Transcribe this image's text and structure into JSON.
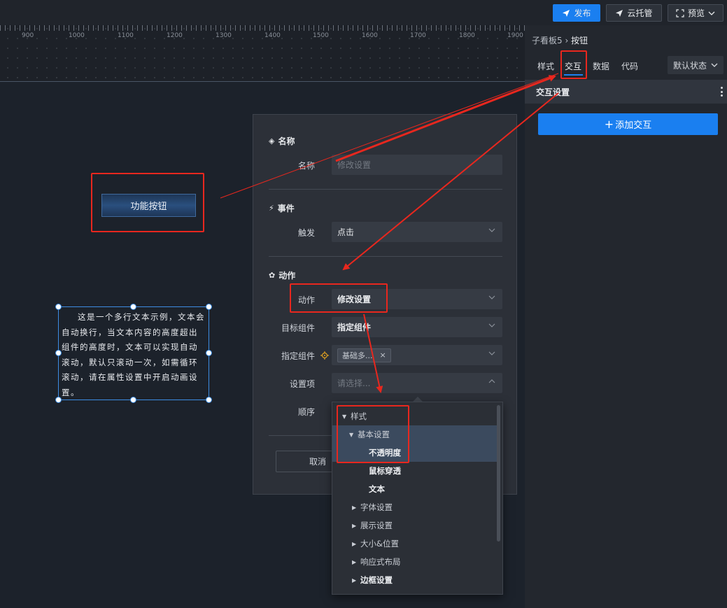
{
  "toolbar": {
    "publish_label": "发布",
    "cloud_label": "云托管",
    "preview_label": "预览"
  },
  "ruler": {
    "labels": [
      "900",
      "1000",
      "1100",
      "1200",
      "1300",
      "1400",
      "1500",
      "1600",
      "1700",
      "1800",
      "1900"
    ]
  },
  "canvas": {
    "function_button_label": "功能按钮",
    "text_widget_content": "这是一个多行文本示例，文本会自动换行，当文本内容的高度超出组件的高度时，文本可以实现自动滚动，默认只滚动一次，如需循环滚动，请在属性设置中开启动画设置。"
  },
  "dialog": {
    "name_section": "名称",
    "name_label": "名称",
    "name_placeholder": "修改设置",
    "event_section": "事件",
    "trigger_label": "触发",
    "trigger_value": "点击",
    "action_section": "动作",
    "action_label": "动作",
    "action_value": "修改设置",
    "target_label": "目标组件",
    "target_value": "指定组件",
    "specified_label": "指定组件",
    "specified_tag": "基础多...",
    "setting_label": "设置项",
    "setting_placeholder": "请选择...",
    "order_label": "顺序",
    "cancel_label": "取消"
  },
  "tree": {
    "items": [
      {
        "label": "样式",
        "level": 0,
        "state": "expanded"
      },
      {
        "label": "基本设置",
        "level": 1,
        "state": "expanded"
      },
      {
        "label": "不透明度",
        "level": 2,
        "state": "leaf"
      },
      {
        "label": "鼠标穿透",
        "level": 2,
        "state": "leaf"
      },
      {
        "label": "文本",
        "level": 2,
        "state": "leaf"
      },
      {
        "label": "字体设置",
        "level": 1,
        "state": "collapsed"
      },
      {
        "label": "展示设置",
        "level": 1,
        "state": "collapsed"
      },
      {
        "label": "大小&位置",
        "level": 1,
        "state": "collapsed"
      },
      {
        "label": "响应式布局",
        "level": 1,
        "state": "collapsed"
      },
      {
        "label": "边框设置",
        "level": 1,
        "state": "collapsed"
      }
    ]
  },
  "panel": {
    "breadcrumb_parent": "子看板5",
    "breadcrumb_current": "按钮",
    "tab_style": "样式",
    "tab_interaction": "交互",
    "tab_data": "数据",
    "tab_code": "代码",
    "state_select": "默认状态",
    "section_title": "交互设置",
    "add_button": "添加交互"
  },
  "colors": {
    "accent": "#1a7ff0",
    "highlight": "#e8271e"
  }
}
